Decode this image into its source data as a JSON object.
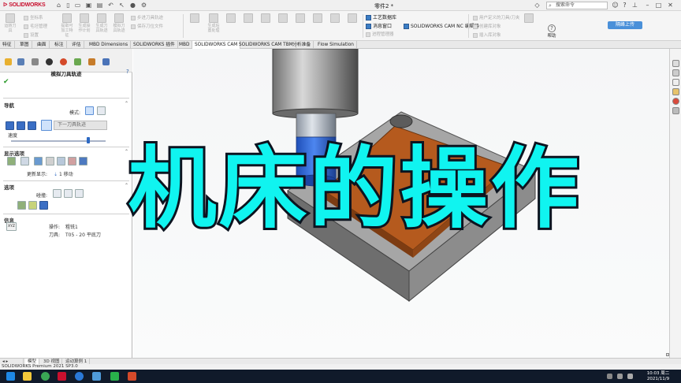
{
  "app": {
    "logo": "SOLIDWORKS",
    "document_title": "零件2 *",
    "search_placeholder": "搜索命令",
    "upload_label": "隔峰上传",
    "help_label": "帮助"
  },
  "ribbon": {
    "groups": [
      {
        "label": "运转刀具"
      },
      {
        "label": "提取可加工特征"
      },
      {
        "label": "生成操作计划"
      },
      {
        "label": "生成刀具轨迹"
      },
      {
        "label": "模拟刀具轨迹"
      },
      {
        "label": "生成后置处理"
      }
    ],
    "small_items": [
      "坐标系",
      "毛坯管理",
      "设置",
      "步进刀具轨迹",
      "保存刀位文件",
      "用户定义的刀具/刀夹",
      "创建库对象",
      "插入库对象",
      "发布 eDrawings"
    ],
    "active_items": [
      "工艺数据库",
      "消息窗口",
      "进程管理器",
      "SOLIDWORKS CAM NC 编辑器"
    ]
  },
  "command_tabs": [
    "特征",
    "草图",
    "曲面",
    "标注",
    "评估",
    "MBD Dimensions",
    "SOLIDWORKS 插件",
    "MBD",
    "SOLIDWORKS CAM",
    "SOLIDWORKS CAM TBM",
    "分析准备",
    "Flow Simulation"
  ],
  "property_manager": {
    "title": "模拟刀具轨迹",
    "nav": {
      "header": "导航",
      "mode_label": "模式:",
      "next_path": "下一刀具轨迹",
      "speed_label": "速度"
    },
    "display": {
      "header": "显示选项",
      "update_label": "更新显示:",
      "update_value": "1 移动"
    },
    "options": {
      "header": "选项",
      "collision_label": "碰撞:"
    },
    "info": {
      "header": "信息",
      "xyz_label": "XYZ",
      "operation_label": "操作:",
      "operation_value": "粗铣1",
      "tool_label": "刀具:",
      "tool_value": "T05 - 20 平底刀"
    }
  },
  "overlay_title": "机床的操作",
  "bottom_tabs": [
    "模型",
    "3D 视图",
    "运动算例 1"
  ],
  "status_text": "SOLIDWORKS Premium 2021 SP3.0",
  "clock": {
    "time": "10:03 周二",
    "date": "2021/11/9"
  },
  "colors": {
    "accent": "#3b7dc4",
    "overlay_fill": "#10f4f0",
    "overlay_stroke": "#0c1420",
    "stock_top": "#a5a5a5",
    "machined": "#b55a1e"
  }
}
